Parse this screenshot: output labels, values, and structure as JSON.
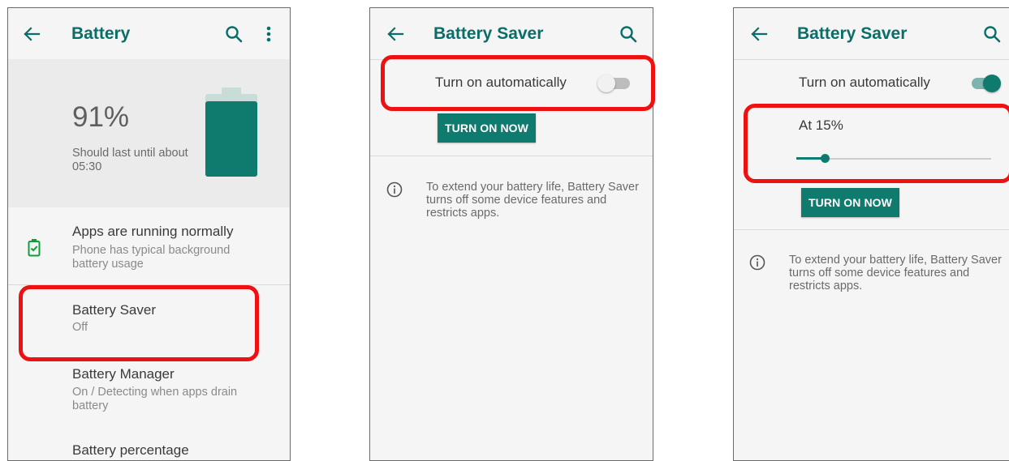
{
  "screen1": {
    "title": "Battery",
    "percentage": "91%",
    "last_until": "Should last until about 05:30",
    "battery_level": 0.91,
    "items": [
      {
        "title": "Apps are running normally",
        "subtitle": "Phone has typical background battery usage"
      },
      {
        "title": "Battery Saver",
        "subtitle": "Off"
      },
      {
        "title": "Battery Manager",
        "subtitle": "On / Detecting when apps drain battery"
      },
      {
        "title": "Battery percentage",
        "subtitle": ""
      }
    ]
  },
  "screen2": {
    "title": "Battery Saver",
    "auto_label": "Turn on automatically",
    "auto_toggle": "off",
    "button_label": "TURN ON NOW",
    "info_text": "To extend your battery life, Battery Saver turns off some device features and restricts apps."
  },
  "screen3": {
    "title": "Battery Saver",
    "auto_label": "Turn on automatically",
    "auto_toggle": "on",
    "threshold_label": "At 15%",
    "threshold_value": 0.15,
    "button_label": "TURN ON NOW",
    "info_text": "To extend your battery life, Battery Saver turns off some device features and restricts apps."
  },
  "colors": {
    "accent": "#0f7a6e",
    "title_teal": "#0a6e68",
    "highlight": "#ee1111",
    "background": "#f5f5f5"
  },
  "icons": {
    "back": "arrow-left-icon",
    "search": "search-icon",
    "more": "more-vert-icon",
    "battery_ok": "battery-check-icon",
    "info": "info-icon"
  }
}
